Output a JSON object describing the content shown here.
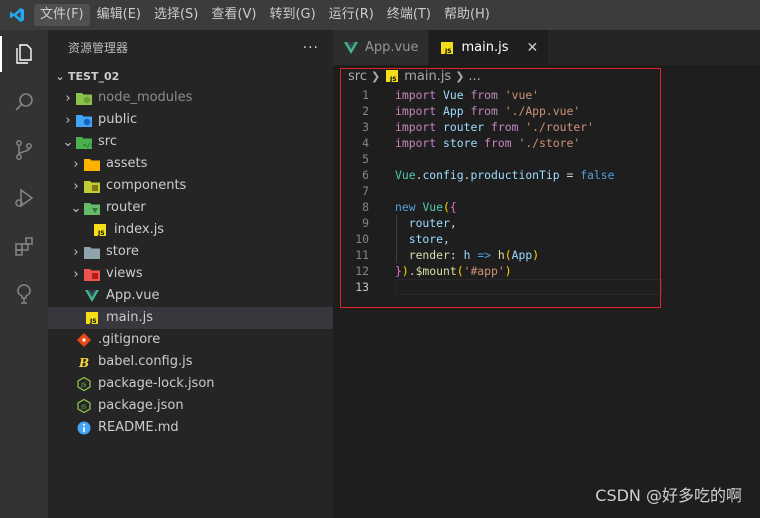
{
  "menu": [
    "文件(F)",
    "编辑(E)",
    "选择(S)",
    "查看(V)",
    "转到(G)",
    "运行(R)",
    "终端(T)",
    "帮助(H)"
  ],
  "activity_bar": [
    "explorer-icon",
    "search-icon",
    "source-control-icon",
    "run-debug-icon",
    "extensions-icon",
    "remote-explorer-icon"
  ],
  "explorer": {
    "title": "资源管理器",
    "more": "···",
    "project": "TEST_02",
    "tree": [
      {
        "label": "node_modules",
        "depth": 1,
        "chev": "›",
        "icon": "node-folder-icon",
        "dim": true
      },
      {
        "label": "public",
        "depth": 1,
        "chev": "›",
        "icon": "public-folder-icon"
      },
      {
        "label": "src",
        "depth": 1,
        "chev": "⌄",
        "icon": "src-folder-icon"
      },
      {
        "label": "assets",
        "depth": 2,
        "chev": "›",
        "icon": "assets-folder-icon"
      },
      {
        "label": "components",
        "depth": 2,
        "chev": "›",
        "icon": "components-folder-icon"
      },
      {
        "label": "router",
        "depth": 2,
        "chev": "⌄",
        "icon": "router-folder-icon"
      },
      {
        "label": "index.js",
        "depth": 3,
        "chev": "",
        "icon": "js-file-icon"
      },
      {
        "label": "store",
        "depth": 2,
        "chev": "›",
        "icon": "store-folder-icon"
      },
      {
        "label": "views",
        "depth": 2,
        "chev": "›",
        "icon": "views-folder-icon"
      },
      {
        "label": "App.vue",
        "depth": 2,
        "chev": "",
        "icon": "vue-file-icon"
      },
      {
        "label": "main.js",
        "depth": 2,
        "chev": "",
        "icon": "js-file-icon",
        "selected": true
      },
      {
        "label": ".gitignore",
        "depth": 1,
        "chev": "",
        "icon": "git-file-icon"
      },
      {
        "label": "babel.config.js",
        "depth": 1,
        "chev": "",
        "icon": "babel-file-icon"
      },
      {
        "label": "package-lock.json",
        "depth": 1,
        "chev": "",
        "icon": "node-file-icon"
      },
      {
        "label": "package.json",
        "depth": 1,
        "chev": "",
        "icon": "node-file-icon"
      },
      {
        "label": "README.md",
        "depth": 1,
        "chev": "",
        "icon": "info-file-icon"
      }
    ]
  },
  "tabs": [
    {
      "label": "App.vue",
      "icon": "vue-file-icon",
      "active": false
    },
    {
      "label": "main.js",
      "icon": "js-file-icon",
      "active": true,
      "close": "✕"
    }
  ],
  "breadcrumb": [
    "src",
    "main.js",
    "..."
  ],
  "code": {
    "current_line": 13,
    "lines": [
      [
        [
          "kw",
          "import"
        ],
        [
          "tx",
          " "
        ],
        [
          "id",
          "Vue"
        ],
        [
          "tx",
          " "
        ],
        [
          "kw",
          "from"
        ],
        [
          "tx",
          " "
        ],
        [
          "str",
          "'vue'"
        ]
      ],
      [
        [
          "kw",
          "import"
        ],
        [
          "tx",
          " "
        ],
        [
          "id",
          "App"
        ],
        [
          "tx",
          " "
        ],
        [
          "kw",
          "from"
        ],
        [
          "tx",
          " "
        ],
        [
          "str",
          "'./App.vue'"
        ]
      ],
      [
        [
          "kw",
          "import"
        ],
        [
          "tx",
          " "
        ],
        [
          "id",
          "router"
        ],
        [
          "tx",
          " "
        ],
        [
          "kw",
          "from"
        ],
        [
          "tx",
          " "
        ],
        [
          "str",
          "'./router'"
        ]
      ],
      [
        [
          "kw",
          "import"
        ],
        [
          "tx",
          " "
        ],
        [
          "id",
          "store"
        ],
        [
          "tx",
          " "
        ],
        [
          "kw",
          "from"
        ],
        [
          "tx",
          " "
        ],
        [
          "str",
          "'./store'"
        ]
      ],
      [],
      [
        [
          "cls",
          "Vue"
        ],
        [
          "tx",
          "."
        ],
        [
          "id",
          "config"
        ],
        [
          "tx",
          "."
        ],
        [
          "id",
          "productionTip"
        ],
        [
          "tx",
          " = "
        ],
        [
          "kb",
          "false"
        ]
      ],
      [],
      [
        [
          "kb",
          "new"
        ],
        [
          "tx",
          " "
        ],
        [
          "cls",
          "Vue"
        ],
        [
          "br",
          "("
        ],
        [
          "br2",
          "{"
        ]
      ],
      [
        [
          "tx",
          "  "
        ],
        [
          "id",
          "router"
        ],
        [
          "tx",
          ","
        ]
      ],
      [
        [
          "tx",
          "  "
        ],
        [
          "id",
          "store"
        ],
        [
          "tx",
          ","
        ]
      ],
      [
        [
          "tx",
          "  "
        ],
        [
          "fn",
          "render"
        ],
        [
          "tx",
          ": "
        ],
        [
          "id",
          "h"
        ],
        [
          "tx",
          " "
        ],
        [
          "kb",
          "=>"
        ],
        [
          "tx",
          " "
        ],
        [
          "fn",
          "h"
        ],
        [
          "br",
          "("
        ],
        [
          "id",
          "App"
        ],
        [
          "br",
          ")"
        ]
      ],
      [
        [
          "br2",
          "}"
        ],
        [
          "br",
          ")"
        ],
        [
          "tx",
          "."
        ],
        [
          "fn",
          "$mount"
        ],
        [
          "br",
          "("
        ],
        [
          "str",
          "'#app'"
        ],
        [
          "br",
          ")"
        ]
      ],
      []
    ]
  },
  "watermark": "CSDN @好多吃的啊",
  "colors": {
    "accent": "#007acc",
    "highlight_border": "#e0242a"
  }
}
